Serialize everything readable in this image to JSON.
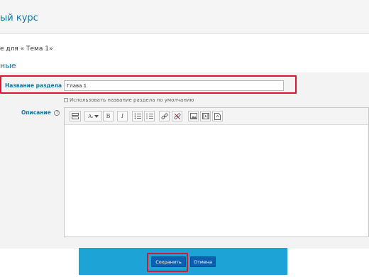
{
  "header": {
    "course_title": "ый курс"
  },
  "subtitle": "е для « Тема 1»",
  "section_legend": "ные",
  "form": {
    "section_name_label": "Название раздела",
    "section_name_value": "Глава 1",
    "use_default_name_label": "Использовать название раздела по умолчанию",
    "description_label": "Описание"
  },
  "toolbar": {
    "format_label": "Aᵢ",
    "bold_label": "B",
    "italic_label": "I",
    "icons": [
      "show-more-buttons-icon",
      "font-style-icon",
      "bold-icon",
      "italic-icon",
      "bullet-list-icon",
      "numbered-list-icon",
      "link-icon",
      "unlink-icon",
      "image-icon",
      "media-icon",
      "manage-files-icon"
    ]
  },
  "buttons": {
    "save_label": "Сохранить",
    "cancel_label": "Отмена"
  },
  "colors": {
    "accent": "#1177aa",
    "highlight": "#d01a35",
    "button_band": "#1ea3d6",
    "button": "#0a5fb0"
  }
}
